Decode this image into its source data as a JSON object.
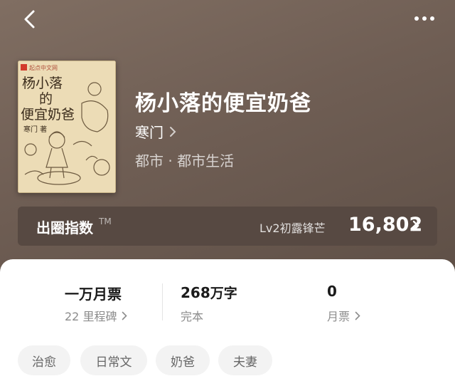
{
  "top_bar": {
    "back_icon": "chevron-left-icon",
    "more_icon": "more-dots-icon"
  },
  "book": {
    "cover": {
      "publisher": "起点中文网",
      "title_line1": "杨小落",
      "title_line2": "的",
      "title_line3": "便宜奶爸",
      "author": "寒门 著"
    },
    "title": "杨小落的便宜奶爸",
    "author": "寒门",
    "category": "都市 · 都市生活"
  },
  "popularity": {
    "label": "出圈指数",
    "tm": "TM",
    "level": "Lv2初露锋芒",
    "value": "16,802"
  },
  "stats": {
    "monthly_ticket_milestone": {
      "value": "一万月票",
      "sub": "22 里程碑"
    },
    "word_count": {
      "value": "268",
      "unit": "万字",
      "sub": "完本"
    },
    "monthly_tickets": {
      "value": "0",
      "sub": "月票"
    }
  },
  "tags": [
    "治愈",
    "日常文",
    "奶爸",
    "夫妻"
  ],
  "colors": {
    "header_bg": "#6f5e54",
    "popularity_bar": "#574942",
    "tag_bg": "#f3f3f3"
  }
}
